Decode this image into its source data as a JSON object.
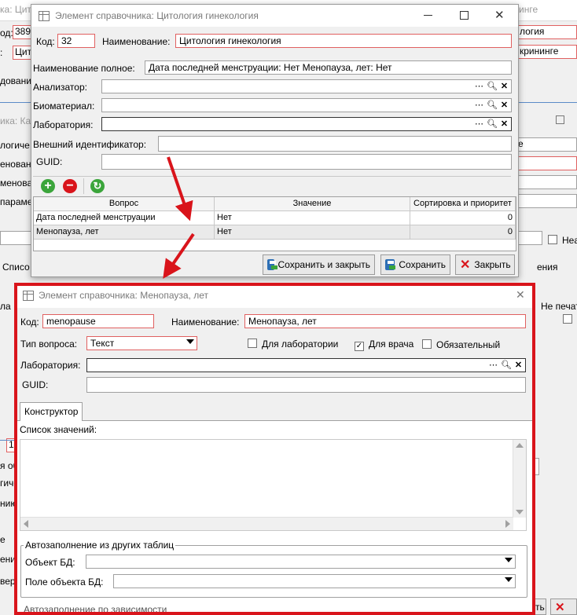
{
  "background": {
    "frag_title_top": "ка: Цито",
    "frag_title_right": "инге",
    "frag_kod": "од:",
    "frag_kod_val": "389",
    "frag_right1": "логия",
    "frag_row2_left": ":",
    "frag_row2_val": "Цит",
    "frag_right2": "крининге",
    "frag_dovanie": "дование",
    "frag_ka": "ика: Ка",
    "frag_logiche": "логиче",
    "frag_e": "е",
    "frag_enova": "енован",
    "frag_menova": "менова",
    "frag_parame": "парамет",
    "frag_neam": "Неам",
    "frag_spisok": "Списо",
    "frag_eniya": "ения",
    "frag_la": "ла",
    "frag_ne_pechat": "Не печат",
    "frag_one": "1",
    "frag_ya_ob": "я об",
    "frag_gich": "гичес",
    "frag_niyu": "нию",
    "frag_e2": "е",
    "frag_eni": "ени",
    "frag_ver": "вер",
    "frag_t": "ть",
    "frag_auto_bottom": "Автозаполнение по зависимости"
  },
  "window1": {
    "title": "Элемент справочника: Цитология гинекология",
    "kod_label": "Код:",
    "kod_value": "32",
    "name_label": "Наименование:",
    "name_value": "Цитология гинекология",
    "fullname_label": "Наименование полное:",
    "fullname_value": "Дата последней менструации: Нет Менопауза, лет: Нет",
    "analyzer_label": "Анализатор:",
    "biomaterial_label": "Биоматериал:",
    "lab_label": "Лаборатория:",
    "extid_label": "Внешний идентификатор:",
    "guid_label": "GUID:",
    "table": {
      "headers": [
        "Вопрос",
        "Значение",
        "Сортировка и приоритет"
      ],
      "rows": [
        [
          "Дата последней менструации",
          "Нет",
          "0"
        ],
        [
          "Менопауза, лет",
          "Нет",
          "0"
        ]
      ]
    },
    "btn_save_close": "Сохранить и закрыть",
    "btn_save": "Сохранить",
    "btn_close": "Закрыть"
  },
  "window2": {
    "title": "Элемент справочника: Менопауза, лет",
    "kod_label": "Код:",
    "kod_value": "menopause",
    "name_label": "Наименование:",
    "name_value": "Менопауза, лет",
    "qtype_label": "Тип вопроса:",
    "qtype_value": "Текст",
    "for_lab_label": "Для лаборатории",
    "for_lab_checked": false,
    "for_doc_label": "Для врача",
    "for_doc_checked": true,
    "mandatory_label": "Обязательный",
    "mandatory_checked": false,
    "lab_label": "Лаборатория:",
    "guid_label": "GUID:",
    "tab_constructor": "Конструктор",
    "values_list_label": "Список значений:",
    "autofill_group": "Автозаполнение из других таблиц",
    "db_object_label": "Объект БД:",
    "db_field_label": "Поле объекта БД:"
  },
  "colors": {
    "highlight_frame": "#d9141b",
    "arrow": "#d9141b",
    "required_border": "#e06060"
  }
}
